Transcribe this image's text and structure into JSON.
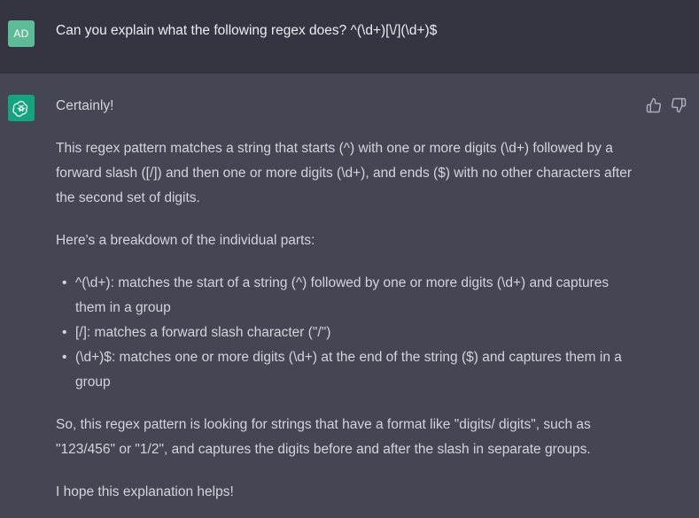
{
  "user": {
    "avatar_initials": "AD",
    "message": "Can you explain what the following regex does? ^(\\d+)[\\/](\\d+)$"
  },
  "assistant": {
    "intro": "Certainly!",
    "para1": "This regex pattern matches a string that starts (^) with one or more digits (\\d+) followed by a forward slash ([/]) and then one or more digits (\\d+), and ends ($) with no other characters after the second set of digits.",
    "para2": "Here's a breakdown of the individual parts:",
    "bullets": [
      "^(\\d+): matches the start of a string (^) followed by one or more digits (\\d+) and captures them in a group",
      "[/]: matches a forward slash character (\"/\")",
      "(\\d+)$: matches one or more digits (\\d+) at the end of the string ($) and captures them in a group"
    ],
    "para3": "So, this regex pattern is looking for strings that have a format like \"digits/ digits\", such as \"123/456\" or \"1/2\", and captures the digits before and after the slash in separate groups.",
    "para4": "I hope this explanation helps!"
  },
  "icons": {
    "assistant_avatar": "openai-logo-icon",
    "thumbs_up": "thumbs-up-icon",
    "thumbs_down": "thumbs-down-icon"
  },
  "colors": {
    "user_bg": "#343541",
    "assistant_bg": "#444654",
    "user_avatar": "#5dbb96",
    "assistant_avatar": "#16a37f",
    "text": "#d1d5db"
  }
}
